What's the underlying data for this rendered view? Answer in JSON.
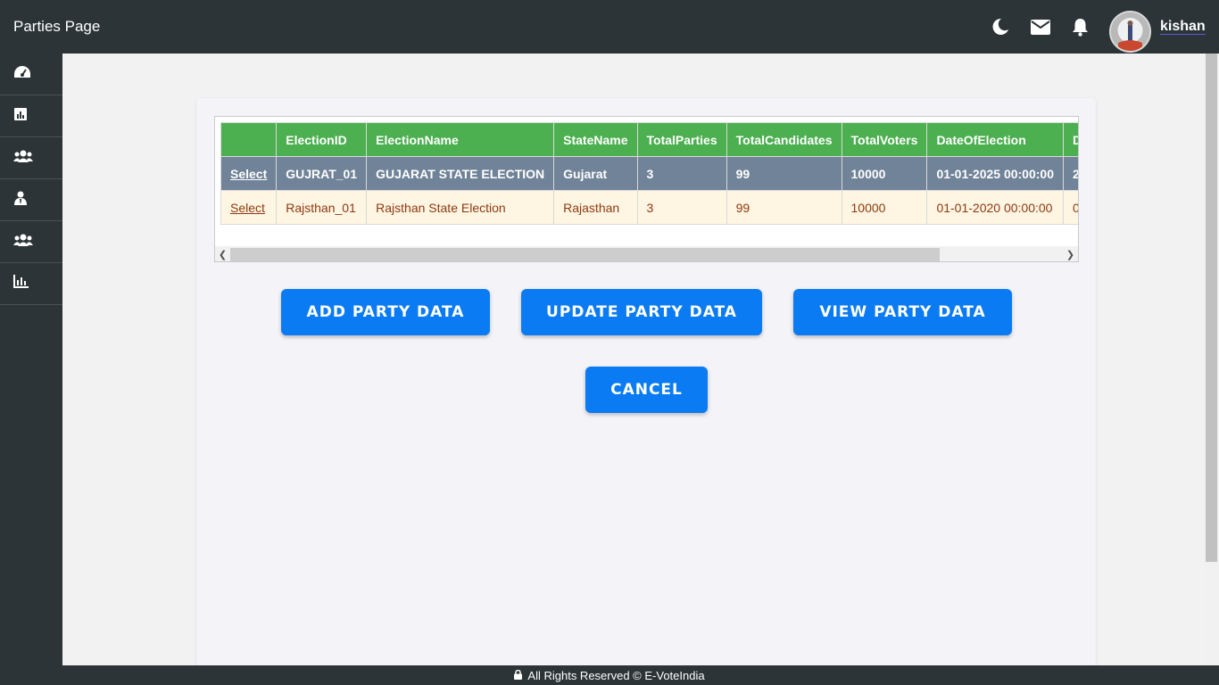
{
  "header": {
    "title": "Parties Page",
    "username": "kishan",
    "icons": [
      "moon-icon",
      "envelope-icon",
      "bell-icon"
    ]
  },
  "sidebar": {
    "items": [
      {
        "icon": "dashboard-icon"
      },
      {
        "icon": "bar-chart-icon"
      },
      {
        "icon": "users-icon"
      },
      {
        "icon": "user-tie-icon"
      },
      {
        "icon": "users-icon"
      },
      {
        "icon": "line-chart-icon"
      }
    ]
  },
  "grid": {
    "columns": [
      "",
      "ElectionID",
      "ElectionName",
      "StateName",
      "TotalParties",
      "TotalCandidates",
      "TotalVoters",
      "DateOfElection",
      "D"
    ],
    "rows": [
      {
        "select": "Select",
        "cells": [
          "GUJRAT_01",
          "GUJARAT STATE ELECTION",
          "Gujarat",
          "3",
          "99",
          "10000",
          "01-01-2025 00:00:00",
          "2"
        ],
        "selected": true
      },
      {
        "select": "Select",
        "cells": [
          "Rajsthan_01",
          "Rajsthan State Election",
          "Rajasthan",
          "3",
          "99",
          "10000",
          "01-01-2020 00:00:00",
          "0"
        ],
        "selected": false
      }
    ]
  },
  "buttons": {
    "add": "ADD PARTY DATA",
    "update": "UPDATE PARTY DATA",
    "view": "VIEW PARTY DATA",
    "cancel": "CANCEL"
  },
  "footer": {
    "text": "All Rights Reserved © E-VoteIndia"
  },
  "colors": {
    "navbar": "#2c3437",
    "header_green": "#4caf50",
    "selected_row": "#708398",
    "normal_row": "#fff5e3",
    "button_blue": "#0a7bf2"
  }
}
